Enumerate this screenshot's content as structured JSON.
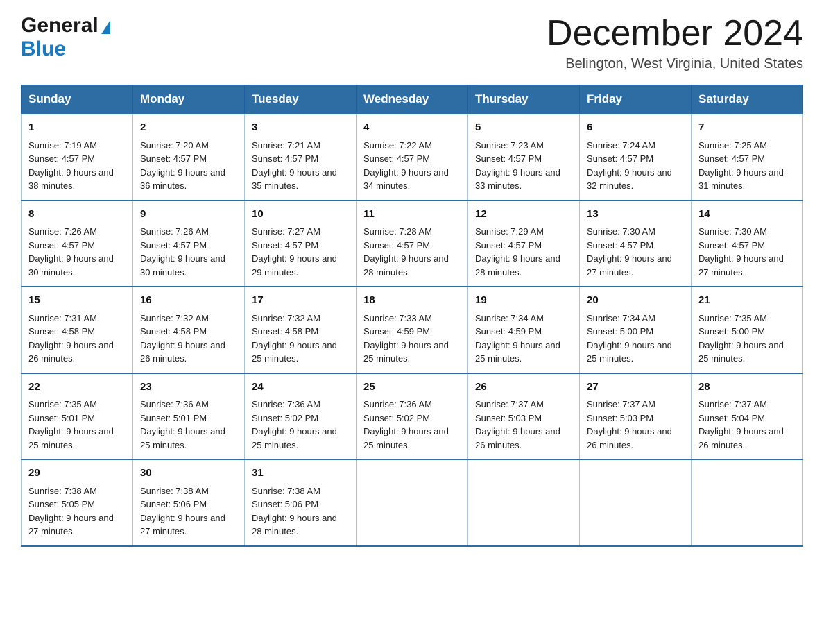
{
  "header": {
    "logo_general": "General",
    "logo_blue": "Blue",
    "title": "December 2024",
    "subtitle": "Belington, West Virginia, United States"
  },
  "calendar": {
    "days": [
      "Sunday",
      "Monday",
      "Tuesday",
      "Wednesday",
      "Thursday",
      "Friday",
      "Saturday"
    ],
    "weeks": [
      [
        {
          "num": "1",
          "sunrise": "7:19 AM",
          "sunset": "4:57 PM",
          "daylight": "9 hours and 38 minutes."
        },
        {
          "num": "2",
          "sunrise": "7:20 AM",
          "sunset": "4:57 PM",
          "daylight": "9 hours and 36 minutes."
        },
        {
          "num": "3",
          "sunrise": "7:21 AM",
          "sunset": "4:57 PM",
          "daylight": "9 hours and 35 minutes."
        },
        {
          "num": "4",
          "sunrise": "7:22 AM",
          "sunset": "4:57 PM",
          "daylight": "9 hours and 34 minutes."
        },
        {
          "num": "5",
          "sunrise": "7:23 AM",
          "sunset": "4:57 PM",
          "daylight": "9 hours and 33 minutes."
        },
        {
          "num": "6",
          "sunrise": "7:24 AM",
          "sunset": "4:57 PM",
          "daylight": "9 hours and 32 minutes."
        },
        {
          "num": "7",
          "sunrise": "7:25 AM",
          "sunset": "4:57 PM",
          "daylight": "9 hours and 31 minutes."
        }
      ],
      [
        {
          "num": "8",
          "sunrise": "7:26 AM",
          "sunset": "4:57 PM",
          "daylight": "9 hours and 30 minutes."
        },
        {
          "num": "9",
          "sunrise": "7:26 AM",
          "sunset": "4:57 PM",
          "daylight": "9 hours and 30 minutes."
        },
        {
          "num": "10",
          "sunrise": "7:27 AM",
          "sunset": "4:57 PM",
          "daylight": "9 hours and 29 minutes."
        },
        {
          "num": "11",
          "sunrise": "7:28 AM",
          "sunset": "4:57 PM",
          "daylight": "9 hours and 28 minutes."
        },
        {
          "num": "12",
          "sunrise": "7:29 AM",
          "sunset": "4:57 PM",
          "daylight": "9 hours and 28 minutes."
        },
        {
          "num": "13",
          "sunrise": "7:30 AM",
          "sunset": "4:57 PM",
          "daylight": "9 hours and 27 minutes."
        },
        {
          "num": "14",
          "sunrise": "7:30 AM",
          "sunset": "4:57 PM",
          "daylight": "9 hours and 27 minutes."
        }
      ],
      [
        {
          "num": "15",
          "sunrise": "7:31 AM",
          "sunset": "4:58 PM",
          "daylight": "9 hours and 26 minutes."
        },
        {
          "num": "16",
          "sunrise": "7:32 AM",
          "sunset": "4:58 PM",
          "daylight": "9 hours and 26 minutes."
        },
        {
          "num": "17",
          "sunrise": "7:32 AM",
          "sunset": "4:58 PM",
          "daylight": "9 hours and 25 minutes."
        },
        {
          "num": "18",
          "sunrise": "7:33 AM",
          "sunset": "4:59 PM",
          "daylight": "9 hours and 25 minutes."
        },
        {
          "num": "19",
          "sunrise": "7:34 AM",
          "sunset": "4:59 PM",
          "daylight": "9 hours and 25 minutes."
        },
        {
          "num": "20",
          "sunrise": "7:34 AM",
          "sunset": "5:00 PM",
          "daylight": "9 hours and 25 minutes."
        },
        {
          "num": "21",
          "sunrise": "7:35 AM",
          "sunset": "5:00 PM",
          "daylight": "9 hours and 25 minutes."
        }
      ],
      [
        {
          "num": "22",
          "sunrise": "7:35 AM",
          "sunset": "5:01 PM",
          "daylight": "9 hours and 25 minutes."
        },
        {
          "num": "23",
          "sunrise": "7:36 AM",
          "sunset": "5:01 PM",
          "daylight": "9 hours and 25 minutes."
        },
        {
          "num": "24",
          "sunrise": "7:36 AM",
          "sunset": "5:02 PM",
          "daylight": "9 hours and 25 minutes."
        },
        {
          "num": "25",
          "sunrise": "7:36 AM",
          "sunset": "5:02 PM",
          "daylight": "9 hours and 25 minutes."
        },
        {
          "num": "26",
          "sunrise": "7:37 AM",
          "sunset": "5:03 PM",
          "daylight": "9 hours and 26 minutes."
        },
        {
          "num": "27",
          "sunrise": "7:37 AM",
          "sunset": "5:03 PM",
          "daylight": "9 hours and 26 minutes."
        },
        {
          "num": "28",
          "sunrise": "7:37 AM",
          "sunset": "5:04 PM",
          "daylight": "9 hours and 26 minutes."
        }
      ],
      [
        {
          "num": "29",
          "sunrise": "7:38 AM",
          "sunset": "5:05 PM",
          "daylight": "9 hours and 27 minutes."
        },
        {
          "num": "30",
          "sunrise": "7:38 AM",
          "sunset": "5:06 PM",
          "daylight": "9 hours and 27 minutes."
        },
        {
          "num": "31",
          "sunrise": "7:38 AM",
          "sunset": "5:06 PM",
          "daylight": "9 hours and 28 minutes."
        },
        null,
        null,
        null,
        null
      ]
    ]
  }
}
